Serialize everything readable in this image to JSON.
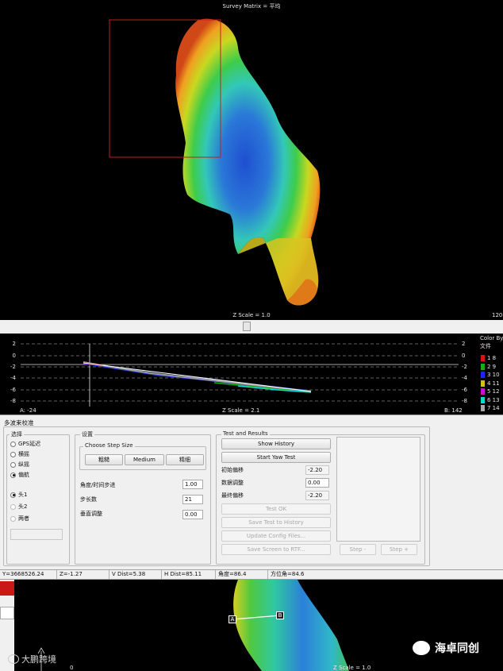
{
  "top_view": {
    "title": "Survey Matrix = 平均",
    "z_scale": "Z Scale = 1.0",
    "corner_value": "120"
  },
  "profile": {
    "y_ticks_left": [
      "2",
      "0",
      "-2",
      "-4",
      "-6",
      "-8"
    ],
    "y_ticks_right": [
      "2",
      "0",
      "-2",
      "-4",
      "-6",
      "-8"
    ],
    "a_label": "A: -24",
    "b_label": "B: 142",
    "z_scale": "Z Scale = 2.1",
    "legend_title_1": "Color By",
    "legend_title_2": "文件",
    "legend": [
      {
        "label": "1 8",
        "color": "#e01010"
      },
      {
        "label": "2 9",
        "color": "#10b010"
      },
      {
        "label": "3 10",
        "color": "#1a2be0"
      },
      {
        "label": "4 11",
        "color": "#d8c010"
      },
      {
        "label": "5 12",
        "color": "#d010d0"
      },
      {
        "label": "6 13",
        "color": "#10d8d8"
      },
      {
        "label": "7 14",
        "color": "#a8a8a8"
      }
    ]
  },
  "dialog": {
    "title": "多波束校准",
    "select_group": {
      "title": "选择",
      "options": [
        {
          "label": "GPS延迟",
          "checked": false,
          "enabled": true
        },
        {
          "label": "横摇",
          "checked": false,
          "enabled": true
        },
        {
          "label": "纵摇",
          "checked": false,
          "enabled": true
        },
        {
          "label": "偏航",
          "checked": true,
          "enabled": true
        }
      ],
      "head_options": [
        {
          "label": "头1",
          "checked": true,
          "enabled": true
        },
        {
          "label": "头2",
          "checked": false,
          "enabled": false
        },
        {
          "label": "两者",
          "checked": false,
          "enabled": false
        }
      ]
    },
    "settings_group": {
      "title": "设置",
      "step_size": {
        "title": "Choose Step Size",
        "buttons": [
          "粗糙",
          "Medium",
          "精细"
        ]
      },
      "angle_label": "角度/时间步进",
      "angle_value": "1.00",
      "steps_label": "步长数",
      "steps_value": "21",
      "vertical_label": "垂直调整",
      "vertical_value": "0.00"
    },
    "results_group": {
      "title": "Test and Results",
      "show_history": "Show History",
      "start_test": "Start Yaw Test",
      "initial_offset_label": "初始偏移",
      "initial_offset_value": "-2.20",
      "data_adjust_label": "数据调整",
      "data_adjust_value": "0.00",
      "final_offset_label": "最终偏移",
      "final_offset_value": "-2.20",
      "test_ok": "Test OK",
      "save_history": "Save Test to History",
      "update_config": "Update Config Files...",
      "save_screen": "Save Screen to RTF...",
      "step_minus": "Step -",
      "step_plus": "Step +"
    }
  },
  "status_bar": {
    "y": "Y=3668526.24",
    "z": "Z=-1.27",
    "v_dist": "V Dist=5.38",
    "h_dist": "H Dist=85.11",
    "angle": "角度=86.4",
    "azimuth": "方位角=84.6"
  },
  "bottom_view": {
    "point_a": "A",
    "point_b": "B",
    "z_scale": "Z Scale = 1.0",
    "axis_zero": "0"
  },
  "watermarks": {
    "left": "大鹏跨境",
    "right": "海卓同创"
  }
}
